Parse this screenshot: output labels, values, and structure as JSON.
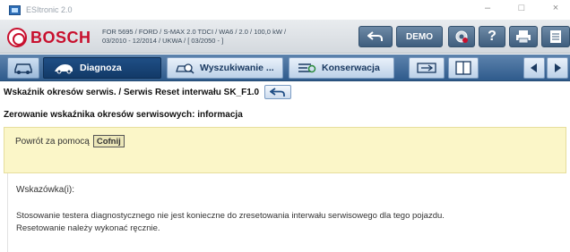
{
  "window": {
    "title": "ESItronic 2.0",
    "controls": {
      "minimize": "–",
      "maximize": "□",
      "close": "×"
    }
  },
  "header": {
    "brand": "BOSCH",
    "vehicle_line1": "FOR 5695 / FORD / S-MAX 2.0 TDCI / WA6 / 2.0 / 100,0 kW /",
    "vehicle_line2": "03/2010 - 12/2014 / UKWA / [ 03/2050 - ]",
    "demo_label": "DEMO",
    "help_label": "?"
  },
  "toolbar": {
    "diagnosis_label": "Diagnoza",
    "search_label": "Wyszukiwanie ...",
    "maintenance_label": "Konserwacja"
  },
  "breadcrumb": {
    "text": "Wskaźnik okresów serwis. / Serwis Reset interwału SK_F1.0"
  },
  "section_title": "Zerowanie wskaźnika okresów serwisowych: informacja",
  "info": {
    "text": "Powrót za pomocą",
    "button_label": "Cofnij"
  },
  "hint": {
    "label": "Wskazówka(i):",
    "line1": "Stosowanie testera diagnostycznego nie jest konieczne do zresetowania interwału serwisowego dla tego pojazdu.",
    "line2": "Resetowanie należy wykonać ręcznie."
  },
  "colors": {
    "brand_red": "#c8102e",
    "toolbar_blue": "#2f5b8c",
    "active_tab": "#1f4e85",
    "info_yellow": "#fbf6c8"
  }
}
